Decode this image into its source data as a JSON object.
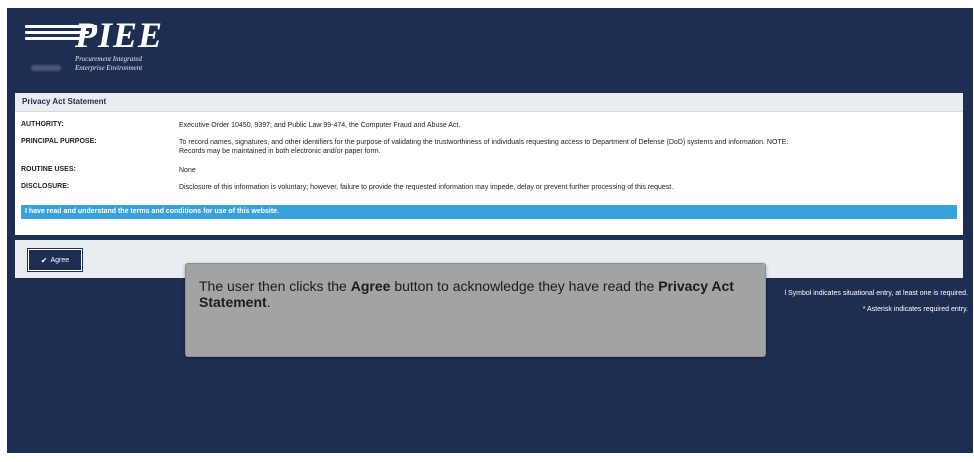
{
  "logo": {
    "name": "PIEE",
    "subtitle_line1": "Procurement Integrated",
    "subtitle_line2": "Enterprise Environment"
  },
  "panel": {
    "title": "Privacy Act Statement",
    "rows": [
      {
        "label": "AUTHORITY:",
        "value": "Executive Order 10450, 9397; and Public Law 99-474, the Computer Fraud and Abuse Act."
      },
      {
        "label": "PRINCIPAL PURPOSE:",
        "value": "To record names, signatures, and other identifiers for the purpose of validating the trustworthiness of individuals requesting access to Department of Defense (DoD) systems and information. NOTE: Records may be maintained in both electronic and/or paper form."
      },
      {
        "label": "ROUTINE USES:",
        "value": "None"
      },
      {
        "label": "DISCLOSURE:",
        "value": "Disclosure of this information is voluntary; however, failure to provide the requested information may impede, delay or prevent further processing of this request."
      }
    ],
    "banner": "I have read and understand the terms and conditions for use of this website."
  },
  "agree_button": {
    "label": "Agree",
    "icon": "check-icon"
  },
  "legend": {
    "situational": "l Symbol indicates situational entry, at least one is required.",
    "required": "* Asterisk indicates required entry."
  },
  "tooltip": {
    "part1": "The user then clicks the ",
    "bold1": "Agree",
    "part2": " button to acknowledge they have read the ",
    "bold2": "Privacy Act Statement",
    "part3": "."
  },
  "colors": {
    "background": "#1e2d52",
    "banner": "#3aa0dc",
    "tooltip": "#a3a3a3"
  }
}
